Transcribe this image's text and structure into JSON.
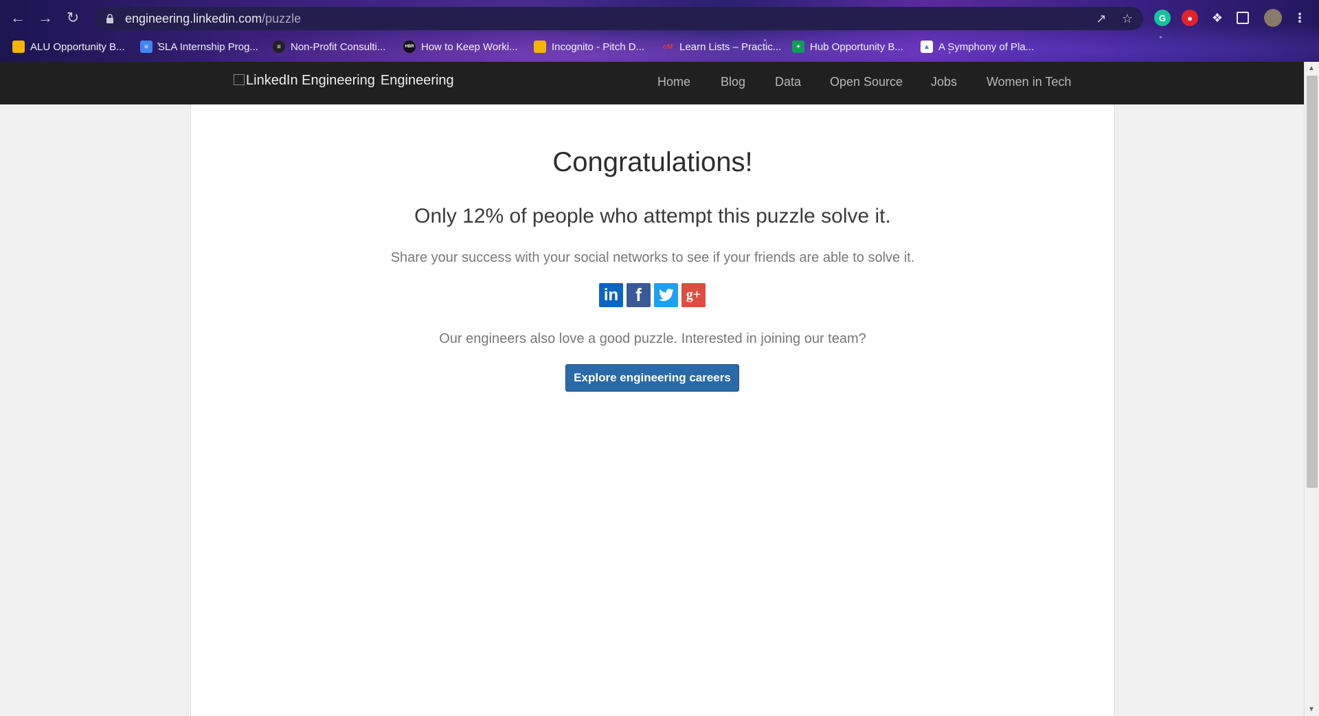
{
  "browser": {
    "url_domain": "engineering.linkedin.com",
    "url_path": "/puzzle",
    "bookmarks": [
      {
        "label": "ALU Opportunity B...",
        "icon": "slides-icon",
        "color": "#f4b400"
      },
      {
        "label": "SLA Internship Prog...",
        "icon": "docs-icon",
        "color": "#4285f4"
      },
      {
        "label": "Non-Profit Consulti...",
        "icon": "globe-icon",
        "color": "#222222"
      },
      {
        "label": "How to Keep Worki...",
        "icon": "hbr-icon",
        "color": "#111111"
      },
      {
        "label": "Incognito - Pitch D...",
        "icon": "slides-icon",
        "color": "#f4b400"
      },
      {
        "label": "Learn Lists – Practic...",
        "icon": "cm-icon",
        "color": "#d32f2f"
      },
      {
        "label": "Hub Opportunity B...",
        "icon": "sheets-icon",
        "color": "#0f9d58"
      },
      {
        "label": "A Symphony of Pla...",
        "icon": "image-icon",
        "color": "#ffffff"
      }
    ]
  },
  "site": {
    "logo_alt": "LinkedIn Engineering",
    "logo_text": "Engineering",
    "nav": [
      "Home",
      "Blog",
      "Data",
      "Open Source",
      "Jobs",
      "Women in Tech"
    ]
  },
  "content": {
    "title": "Congratulations!",
    "subtitle": "Only 12% of people who attempt this puzzle solve it.",
    "share_text": "Share your success with your social networks to see if your friends are able to solve it.",
    "social": [
      {
        "name": "linkedin",
        "glyph": "in",
        "color": "#0a66c2"
      },
      {
        "name": "facebook",
        "glyph": "f",
        "color": "#3b5998"
      },
      {
        "name": "twitter",
        "glyph": "t",
        "color": "#1da1f2"
      },
      {
        "name": "google-plus",
        "glyph": "g+",
        "color": "#dc4e41"
      }
    ],
    "team_text": "Our engineers also love a good puzzle. Interested in joining our team?",
    "cta_label": "Explore engineering careers"
  }
}
